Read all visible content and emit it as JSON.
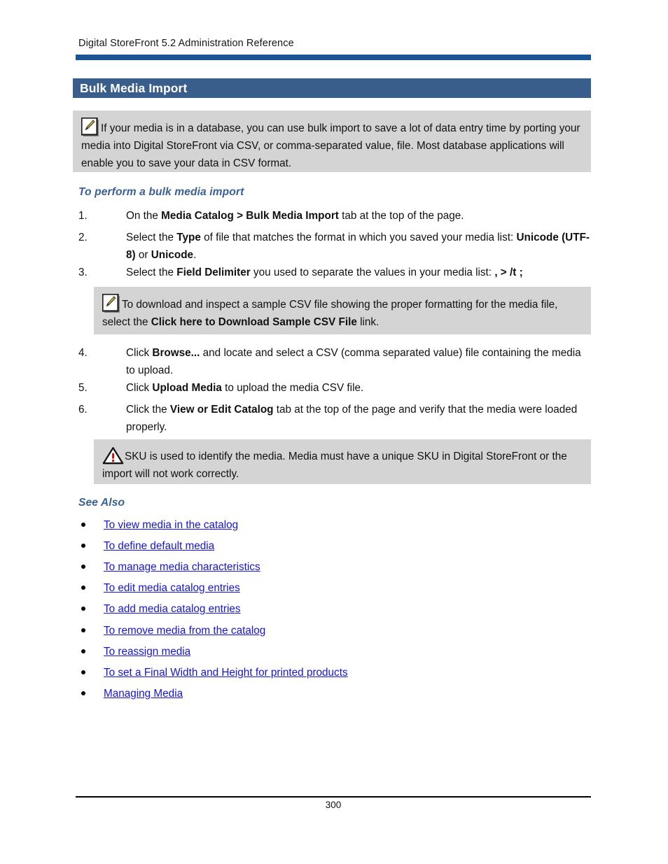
{
  "document": {
    "running_header": "Digital StoreFront 5.2 Administration Reference",
    "page_number": "300",
    "title": "Bulk Media Import"
  },
  "colors": {
    "title_bar": "#3A5E8C",
    "header_rule": "#1B5494",
    "subheading": "#3A6098",
    "callout_bg": "#D4D4D4",
    "link": "#1414E0"
  },
  "notes": {
    "intro": {
      "icon": "pencil-note-icon",
      "text": "If your media is in a database, you can use bulk import to save a lot of data entry time by porting your media into Digital StoreFront via CSV, or comma-separated value, file. Most database applications will enable you to save your data in CSV format."
    },
    "sample_csv": {
      "icon": "pencil-note-icon",
      "text_before": "To download and inspect a sample CSV file showing the proper formatting for the media file, select the ",
      "bold": "Click here to Download Sample CSV File",
      "text_after": " link."
    },
    "warning_sku": {
      "icon": "warning-triangle-icon",
      "text": "SKU is used to identify the media. Media must have a unique SKU in Digital StoreFront or the import will not work correctly."
    }
  },
  "procedure": {
    "heading": "To perform a bulk media import",
    "steps": [
      {
        "number": "1.",
        "p1": "On the ",
        "b1": "Media Catalog > Bulk Media Import",
        "p2": " tab at the top of the page.",
        "b2": "",
        "p3": ""
      },
      {
        "number": "2.",
        "p1": "Select the ",
        "b1": "Type",
        "p2": " of file that matches the format in which you saved your media list: ",
        "b2": "Unicode (UTF-8)",
        "p3": " or ",
        "b3": "Unicode",
        "p4": "."
      },
      {
        "number": "3.",
        "p1": "Select the ",
        "b1": "Field Delimiter",
        "p2": " you used to separate the values in your media list: ",
        "b2": ", > /t ;",
        "p3": ""
      },
      {
        "number": "4.",
        "p1": "Click ",
        "b1": "Browse...",
        "p2": " and locate and select a CSV (comma separated value) file containing the media to upload.",
        "b2": "",
        "p3": ""
      },
      {
        "number": "5.",
        "p1": "Click ",
        "b1": "Upload Media",
        "p2": " to upload the media CSV file.",
        "b2": "",
        "p3": ""
      },
      {
        "number": "6.",
        "p1": "Click the ",
        "b1": "View or Edit Catalog",
        "p2": " tab at the top of the page and verify that the media were loaded properly.",
        "b2": "",
        "p3": ""
      }
    ]
  },
  "see_also": {
    "heading": "See Also",
    "links": [
      "To view media in the catalog",
      "To define default media",
      "To manage media characteristics",
      "To edit media catalog entries",
      "To add media catalog entries",
      "To remove media from the catalog",
      "To reassign media",
      "To set a Final Width and Height for printed products",
      "Managing Media"
    ]
  }
}
